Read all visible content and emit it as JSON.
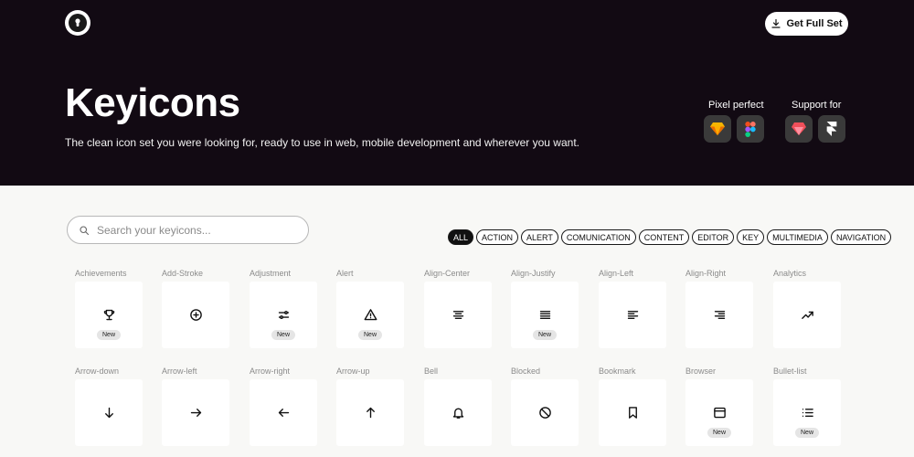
{
  "header": {
    "logo_icon": "keyhole-icon",
    "cta_label": "Get Full Set",
    "cta_icon": "download-icon",
    "title": "Keyicons",
    "subtitle": "The clean icon set you were looking for, ready to use in web, mobile development and wherever you want.",
    "pixel_perfect_label": "Pixel perfect",
    "support_label": "Support for",
    "pixel_perfect_apps": [
      "sketch-icon",
      "figma-icon"
    ],
    "support_apps": [
      "craft-icon",
      "framer-icon"
    ]
  },
  "search": {
    "placeholder": "Search your keyicons...",
    "value": ""
  },
  "filters": [
    "ALL",
    "ACTION",
    "ALERT",
    "COMUNICATION",
    "CONTENT",
    "EDITOR",
    "KEY",
    "MULTIMEDIA",
    "NAVIGATION"
  ],
  "active_filter": "ALL",
  "badge_text": "New",
  "icons": [
    {
      "label": "Achievements",
      "icon": "trophy-icon",
      "new": true
    },
    {
      "label": "Add-Stroke",
      "icon": "add-circle-icon",
      "new": false
    },
    {
      "label": "Adjustment",
      "icon": "sliders-icon",
      "new": true
    },
    {
      "label": "Alert",
      "icon": "warning-triangle-icon",
      "new": true
    },
    {
      "label": "Align-Center",
      "icon": "align-center-icon",
      "new": false
    },
    {
      "label": "Align-Justify",
      "icon": "align-justify-icon",
      "new": true
    },
    {
      "label": "Align-Left",
      "icon": "align-left-icon",
      "new": false
    },
    {
      "label": "Align-Right",
      "icon": "align-right-icon",
      "new": false
    },
    {
      "label": "Analytics",
      "icon": "trend-up-icon",
      "new": false
    },
    {
      "label": "Arrow-down",
      "icon": "arrow-down-icon",
      "new": false
    },
    {
      "label": "Arrow-left",
      "icon": "arrow-right-icon",
      "new": false
    },
    {
      "label": "Arrow-right",
      "icon": "arrow-left-icon",
      "new": false
    },
    {
      "label": "Arrow-up",
      "icon": "arrow-up-icon",
      "new": false
    },
    {
      "label": "Bell",
      "icon": "bell-icon",
      "new": false
    },
    {
      "label": "Blocked",
      "icon": "blocked-icon",
      "new": false
    },
    {
      "label": "Bookmark",
      "icon": "bookmark-icon",
      "new": false
    },
    {
      "label": "Browser",
      "icon": "browser-icon",
      "new": true
    },
    {
      "label": "Bullet-list",
      "icon": "bullet-list-icon",
      "new": true
    }
  ]
}
